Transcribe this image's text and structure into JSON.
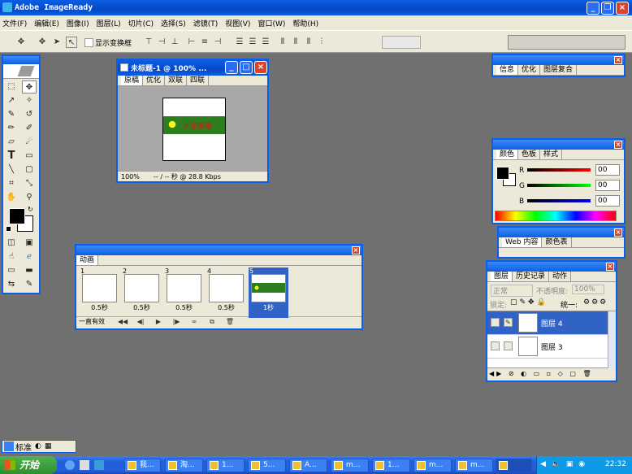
{
  "app": {
    "title": "Adobe ImageReady"
  },
  "menu": [
    "文件(F)",
    "编辑(E)",
    "图像(I)",
    "图层(L)",
    "切片(C)",
    "选择(S)",
    "滤镜(T)",
    "视图(V)",
    "窗口(W)",
    "帮助(H)"
  ],
  "options": {
    "show_transform": "显示变换框"
  },
  "doc": {
    "title": "未标题-1 @ 100% ...",
    "tabs": [
      "原稿",
      "优化",
      "双联",
      "四联"
    ],
    "zoom": "100%",
    "status": "-- / -- 秒 @ 28.8 Kbps",
    "banner_text": "大家都来"
  },
  "animation": {
    "title": "动画",
    "frames": [
      {
        "num": "1",
        "delay": "0.5秒"
      },
      {
        "num": "2",
        "delay": "0.5秒"
      },
      {
        "num": "3",
        "delay": "0.5秒"
      },
      {
        "num": "4",
        "delay": "0.5秒"
      },
      {
        "num": "5",
        "delay": "1秒"
      }
    ],
    "loop": "一直有效"
  },
  "info_panel": {
    "tabs": [
      "信息",
      "优化",
      "图层复合"
    ]
  },
  "color_panel": {
    "tabs": [
      "颜色",
      "色板",
      "样式"
    ],
    "channels": [
      {
        "label": "R",
        "value": "00"
      },
      {
        "label": "G",
        "value": "00"
      },
      {
        "label": "B",
        "value": "00"
      }
    ]
  },
  "web_panel": {
    "tabs": [
      "Web 内容",
      "颜色表"
    ]
  },
  "layers_panel": {
    "tabs": [
      "图层",
      "历史记录",
      "动作"
    ],
    "blend": "正常",
    "opacity_label": "不透明度:",
    "opacity": "100%",
    "lock_label": "锁定:",
    "unify_label": "统一:",
    "layers": [
      {
        "name": "图层 4",
        "selected": true
      },
      {
        "name": "图层 3",
        "selected": false
      }
    ]
  },
  "bottom_tray": {
    "label": "标准"
  },
  "taskbar": {
    "start": "开始",
    "items": [
      "我...",
      "淘...",
      "1...",
      "5...",
      "A...",
      "m...",
      "1...",
      "m...",
      "m..."
    ],
    "time": "22:32"
  }
}
